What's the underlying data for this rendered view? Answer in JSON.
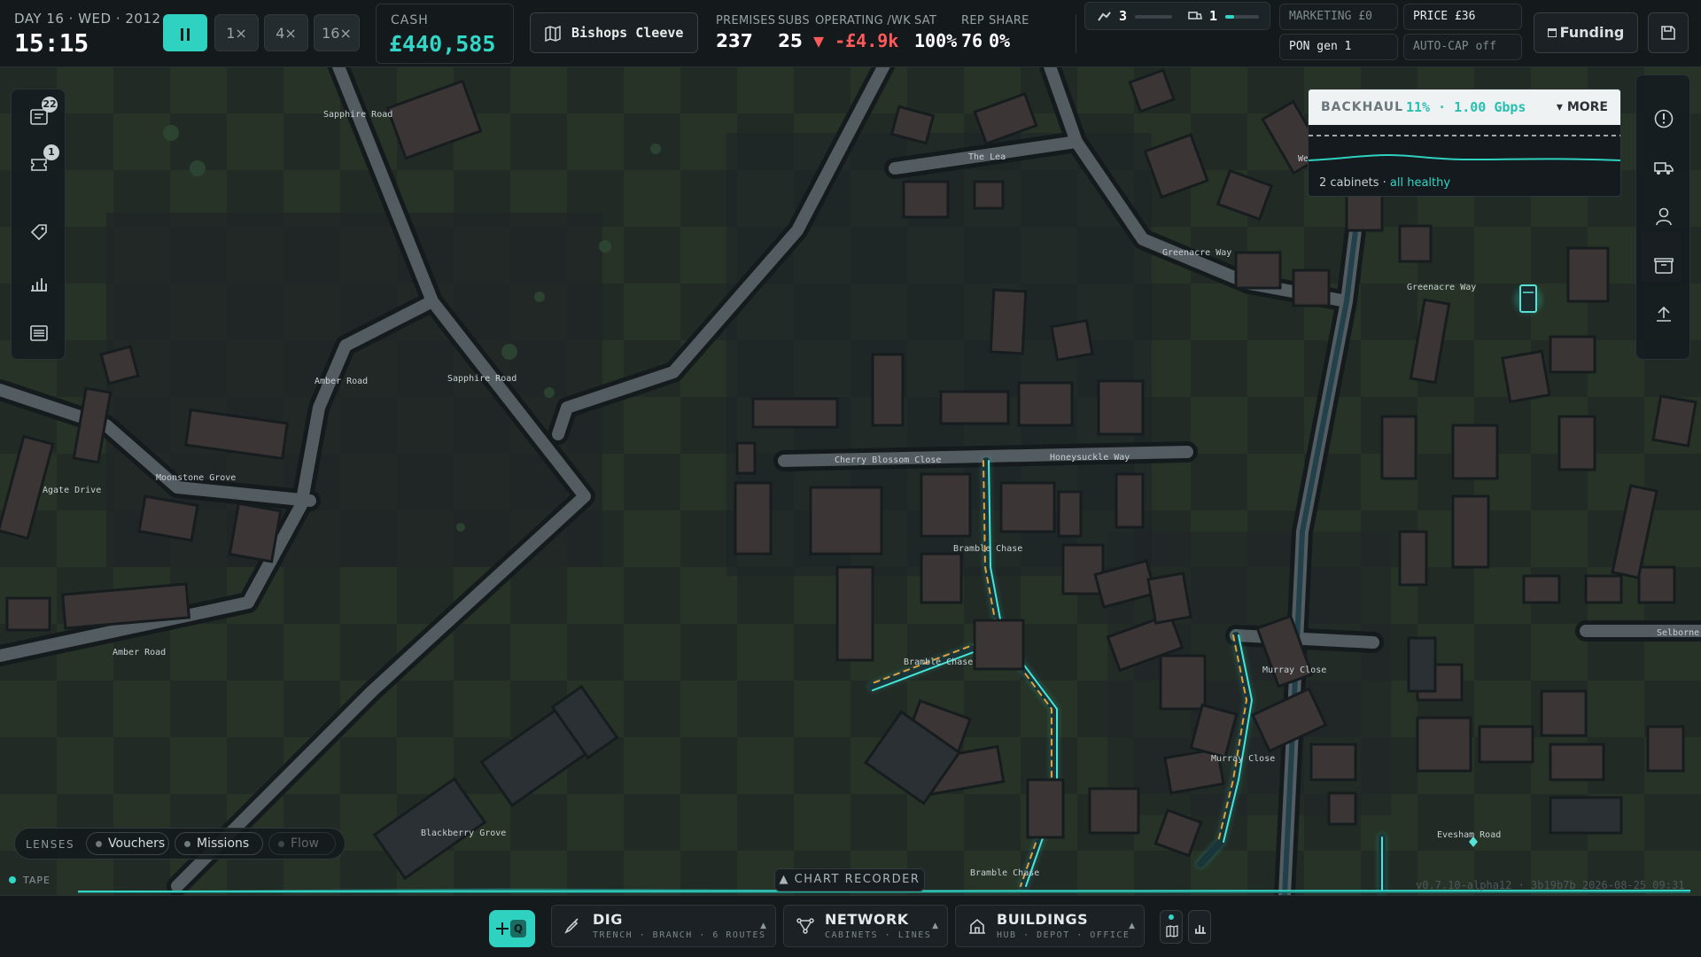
{
  "header": {
    "day_line": "DAY 16 · WED · 2012",
    "clock": "15:15",
    "speeds": [
      "1×",
      "4×",
      "16×"
    ],
    "cash_label": "CASH",
    "cash_value": "£440,585",
    "town": "Bishops Cleeve",
    "stats": [
      {
        "label": "PREMISES",
        "value": "237"
      },
      {
        "label": "SUBS",
        "value": "25"
      },
      {
        "label": "OPERATING /WK",
        "value": "▼ -£4.9k"
      },
      {
        "label": "SAT",
        "value": "100%"
      },
      {
        "label": "REP",
        "value": "76"
      },
      {
        "label": "SHARE",
        "value": "0%"
      }
    ],
    "crews": {
      "diggers": "3",
      "vans": "1"
    },
    "marketing": "MARKETING £0",
    "price": "PRICE £36",
    "pon": "PON gen 1",
    "autocap": "AUTO-CAP off",
    "funding": "Funding"
  },
  "left_rail": {
    "messages_badge": "22",
    "tickets_badge": "1"
  },
  "backhaul": {
    "title": "BACKHAUL",
    "value": "11% · 1.00 Gbps",
    "more": "▾ MORE",
    "footer_prefix": "2 cabinets · ",
    "footer_status": "all healthy"
  },
  "map_labels": [
    "Sapphire Road",
    "Sapphire Road",
    "Amber Road",
    "Amber Road",
    "Agate Drive",
    "Moonstone Grove",
    "The Lea",
    "Greenacre Way",
    "Greenacre Way",
    "Cherry Blossom Close",
    "Honeysuckle Way",
    "Bramble Chase",
    "Bramble Chase",
    "Bramble Chase",
    "Murray Close",
    "Murray Close",
    "Blackberry Grove",
    "Evesham Road",
    "Selborne",
    "We"
  ],
  "lenses": {
    "title": "LENSES",
    "items": [
      "Vouchers",
      "Missions",
      "Flow"
    ]
  },
  "tape": {
    "label": "TAPE",
    "chart_recorder": "▲ CHART RECORDER",
    "version": "v0.7.10-alpha12 · 3b19b7b 2026-08-25 09:31"
  },
  "toolbar": {
    "select_key": "Q",
    "tools": [
      {
        "name": "DIG",
        "sub": "TRENCH · BRANCH · 6 ROUTES"
      },
      {
        "name": "NETWORK",
        "sub": "CABINETS · LINES"
      },
      {
        "name": "BUILDINGS",
        "sub": "HUB · DEPOT · OFFICE"
      }
    ]
  },
  "colors": {
    "accent": "#2fd1c0",
    "negative": "#ff5a5a",
    "road": "#4b5459",
    "grass": "#243128",
    "building": "#3a3434"
  }
}
